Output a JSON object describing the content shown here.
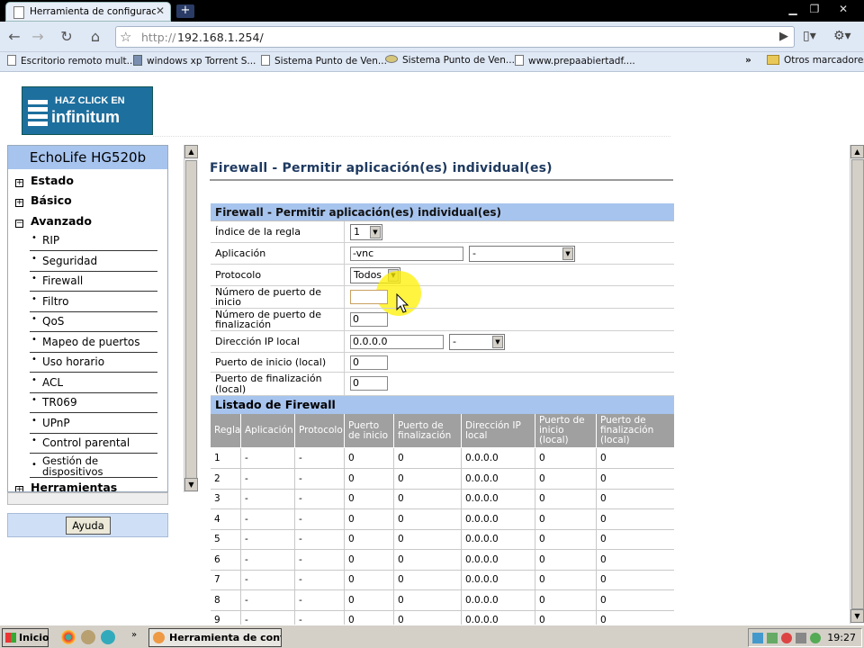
{
  "browser": {
    "tab_title": "Herramienta de configuraci...",
    "url_scheme": "http://",
    "url_host": "192.168.1.254/",
    "bookmarks": [
      "Escritorio remoto mult...",
      "windows xp Torrent S...",
      "Sistema Punto de Ven...",
      "Sistema Punto de Ven...",
      "www.prepaabiertadf...."
    ],
    "other_bookmarks": "Otros marcadores"
  },
  "banner": {
    "line1": "HAZ CLICK EN",
    "line2": "infinitum"
  },
  "sidebar": {
    "title": "EchoLife HG520b",
    "sections": {
      "estado": "Estado",
      "basico": "Básico",
      "avanzado": "Avanzado",
      "herramientas": "Herramientas"
    },
    "items": [
      "RIP",
      "Seguridad",
      "Firewall",
      "Filtro",
      "QoS",
      "Mapeo de puertos",
      "Uso horario",
      "ACL",
      "TR069",
      "UPnP",
      "Control parental",
      "Gestión de dispositivos"
    ],
    "help": "Ayuda"
  },
  "page": {
    "title": "Firewall - Permitir aplicación(es) individual(es)",
    "form_header": "Firewall - Permitir aplicación(es) individual(es)",
    "fields": {
      "rule_index": {
        "label": "Índice de la regla",
        "value": "1"
      },
      "application": {
        "label": "Aplicación",
        "value": "-vnc",
        "select": "-"
      },
      "protocol": {
        "label": "Protocolo",
        "value": "Todos"
      },
      "start_port": {
        "label": "Número de puerto de inicio",
        "value": ""
      },
      "end_port": {
        "label": "Número de puerto de finalización",
        "value": "0"
      },
      "local_ip": {
        "label": "Dirección IP local",
        "value": "0.0.0.0",
        "select": "-"
      },
      "local_start": {
        "label": "Puerto de inicio (local)",
        "value": "0"
      },
      "local_end": {
        "label": "Puerto de finalización (local)",
        "value": "0"
      }
    },
    "list_header": "Listado de Firewall",
    "columns": [
      "Regla",
      "Aplicación",
      "Protocolo",
      "Puerto de inicio",
      "Puerto de finalización",
      "Dirección IP local",
      "Puerto de inicio (local)",
      "Puerto de finalización (local)"
    ],
    "rows": [
      [
        "1",
        "-",
        "-",
        "0",
        "0",
        "0.0.0.0",
        "0",
        "0"
      ],
      [
        "2",
        "-",
        "-",
        "0",
        "0",
        "0.0.0.0",
        "0",
        "0"
      ],
      [
        "3",
        "-",
        "-",
        "0",
        "0",
        "0.0.0.0",
        "0",
        "0"
      ],
      [
        "4",
        "-",
        "-",
        "0",
        "0",
        "0.0.0.0",
        "0",
        "0"
      ],
      [
        "5",
        "-",
        "-",
        "0",
        "0",
        "0.0.0.0",
        "0",
        "0"
      ],
      [
        "6",
        "-",
        "-",
        "0",
        "0",
        "0.0.0.0",
        "0",
        "0"
      ],
      [
        "7",
        "-",
        "-",
        "0",
        "0",
        "0.0.0.0",
        "0",
        "0"
      ],
      [
        "8",
        "-",
        "-",
        "0",
        "0",
        "0.0.0.0",
        "0",
        "0"
      ],
      [
        "9",
        "-",
        "-",
        "0",
        "0",
        "0.0.0.0",
        "0",
        "0"
      ]
    ]
  },
  "taskbar": {
    "start": "Inicio",
    "task": "Herramienta de confi...",
    "clock": "19:27"
  }
}
